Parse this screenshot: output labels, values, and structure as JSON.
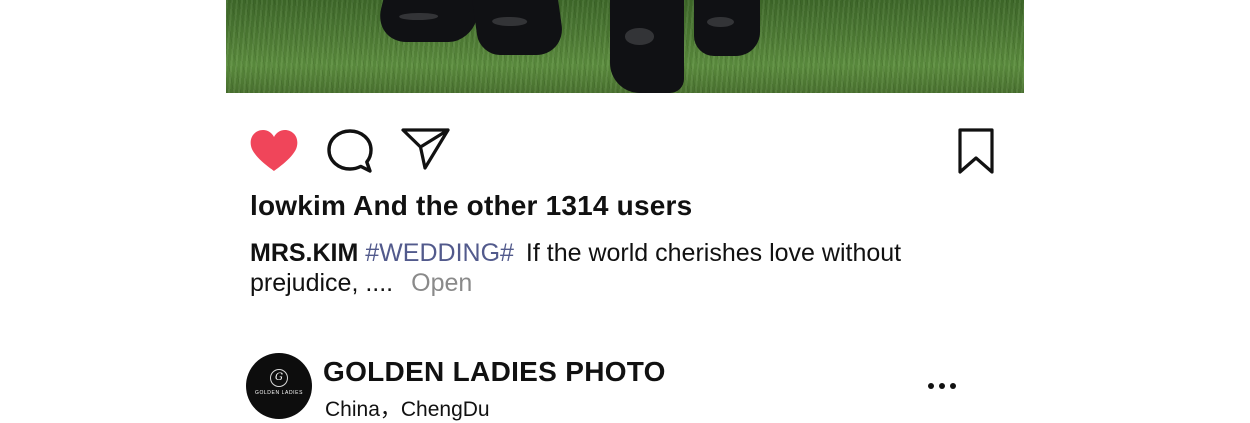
{
  "post": {
    "likes_text": "lowkim And the other 1314 users",
    "caption": {
      "author": "MRS.KIM",
      "hashtag": "#WEDDING#",
      "text": "If the world cherishes love without prejudice, ....",
      "open_label": "Open"
    },
    "liked": true,
    "accent_color": "#f0455a",
    "hashtag_color": "#525a8c",
    "muted_color": "#8a8a8a"
  },
  "actions": {
    "like_icon": "heart-icon",
    "comment_icon": "comment-icon",
    "share_icon": "send-icon",
    "save_icon": "bookmark-icon"
  },
  "account": {
    "name": "GOLDEN LADIES PHOTO",
    "location": "China，ChengDu",
    "avatar_text": "GOLDEN LADIES",
    "avatar_mark": "G",
    "more_icon": "more-icon"
  }
}
